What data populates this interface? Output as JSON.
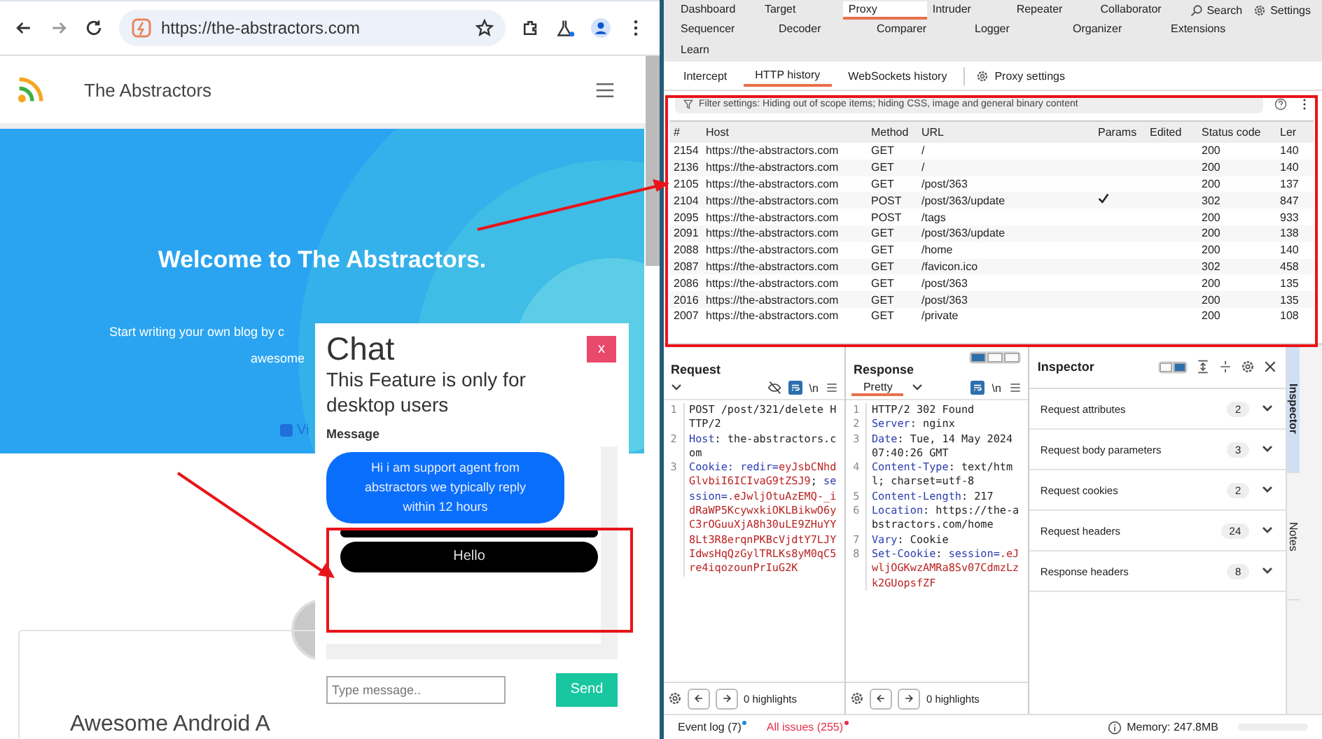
{
  "browser": {
    "url": "https://the-abstractors.com"
  },
  "site": {
    "title": "The Abstractors",
    "hero_title": "Welcome to The Abstractors.",
    "hero_lines": [
      "Start writing your own blog by c",
      "awesome"
    ],
    "hero_link": "Vi",
    "card_title": "Awesome Android A"
  },
  "chat": {
    "title": "Chat",
    "subtitle": "This Feature is only for desktop users",
    "close": "x",
    "label": "Message",
    "placeholder": "Type message..",
    "send": "Send",
    "messages": [
      {
        "kind": "agent",
        "text": "Hi i am support agent from abstractors we typically reply within 12 hours"
      },
      {
        "kind": "blank"
      },
      {
        "kind": "user",
        "text": "Hello"
      }
    ]
  },
  "burp": {
    "nav_rows": [
      [
        {
          "label": "Dashboard",
          "selected": false
        },
        {
          "label": "Target",
          "selected": false
        },
        {
          "label": "Proxy",
          "selected": true
        },
        {
          "label": "Intruder",
          "selected": false
        },
        {
          "label": "Repeater",
          "selected": false
        },
        {
          "label": "Collaborator",
          "selected": false
        }
      ],
      [
        {
          "label": "Sequencer",
          "selected": false
        },
        {
          "label": "Decoder",
          "selected": false
        },
        {
          "label": "Comparer",
          "selected": false
        },
        {
          "label": "Logger",
          "selected": false
        },
        {
          "label": "Organizer",
          "selected": false
        },
        {
          "label": "Extensions",
          "selected": false
        }
      ],
      [
        {
          "label": "Learn",
          "selected": false
        }
      ]
    ],
    "search": "Search",
    "settings": "Settings",
    "subtabs": [
      {
        "label": "Intercept",
        "selected": false,
        "kind": "tab"
      },
      {
        "label": "HTTP history",
        "selected": true,
        "kind": "tab"
      },
      {
        "label": "WebSockets history",
        "selected": false,
        "kind": "tab"
      },
      {
        "label": "Proxy settings",
        "selected": false,
        "kind": "settings"
      }
    ],
    "filter": "Filter settings: Hiding out of scope items; hiding CSS, image and general binary content",
    "columns": [
      "#",
      "Host",
      "Method",
      "URL",
      "Params",
      "Edited",
      "Status code",
      "Ler"
    ],
    "rows": [
      {
        "num": "2154",
        "host": "https://the-abstractors.com",
        "method": "GET",
        "url": "/",
        "params": false,
        "status": "200",
        "length": "140"
      },
      {
        "num": "2136",
        "host": "https://the-abstractors.com",
        "method": "GET",
        "url": "/",
        "params": false,
        "status": "200",
        "length": "140"
      },
      {
        "num": "2105",
        "host": "https://the-abstractors.com",
        "method": "GET",
        "url": "/post/363",
        "params": false,
        "status": "200",
        "length": "137"
      },
      {
        "num": "2104",
        "host": "https://the-abstractors.com",
        "method": "POST",
        "url": "/post/363/update",
        "params": true,
        "status": "302",
        "length": "847"
      },
      {
        "num": "2095",
        "host": "https://the-abstractors.com",
        "method": "POST",
        "url": "/tags",
        "params": false,
        "status": "200",
        "length": "933"
      },
      {
        "num": "2091",
        "host": "https://the-abstractors.com",
        "method": "GET",
        "url": "/post/363/update",
        "params": false,
        "status": "200",
        "length": "138"
      },
      {
        "num": "2088",
        "host": "https://the-abstractors.com",
        "method": "GET",
        "url": "/home",
        "params": false,
        "status": "200",
        "length": "140"
      },
      {
        "num": "2087",
        "host": "https://the-abstractors.com",
        "method": "GET",
        "url": "/favicon.ico",
        "params": false,
        "status": "302",
        "length": "458"
      },
      {
        "num": "2086",
        "host": "https://the-abstractors.com",
        "method": "GET",
        "url": "/post/363",
        "params": false,
        "status": "200",
        "length": "135"
      },
      {
        "num": "2016",
        "host": "https://the-abstractors.com",
        "method": "GET",
        "url": "/post/363",
        "params": false,
        "status": "200",
        "length": "135"
      },
      {
        "num": "2007",
        "host": "https://the-abstractors.com",
        "method": "GET",
        "url": "/private",
        "params": false,
        "status": "200",
        "length": "108"
      }
    ],
    "request": {
      "title": "Request",
      "newline": "\\n",
      "highlights": "0 highlights",
      "lines": [
        {
          "num": "1",
          "parts": [
            {
              "kind": "plain",
              "text": "POST /post/321/delete HTTP/2"
            }
          ]
        },
        {
          "num": "2",
          "parts": [
            {
              "kind": "name",
              "text": "Host"
            },
            {
              "kind": "plain",
              "text": ": the-abstractors.com"
            }
          ]
        },
        {
          "num": "3",
          "parts": [
            {
              "kind": "name",
              "text": "Cookie: redir="
            },
            {
              "kind": "value",
              "text": "eyJsbCNhdGlvbiI6ICIvaG9tZSJ9"
            },
            {
              "kind": "plain",
              "text": "; "
            },
            {
              "kind": "name",
              "text": "session="
            },
            {
              "kind": "value",
              "text": ".eJwljOtuAzEMQ-_idRaWP5KcywxkiOKLBikwO6yC3rOGuuXjA8h30uLE9ZHuYY8Lt3R8erqnPKBcVjdtY7LJYIdwsHqQzGylTRLKs8yM0qC5re4iqozounPrIuG2K"
            }
          ]
        }
      ]
    },
    "response": {
      "title": "Response",
      "tab": "Pretty",
      "newline": "\\n",
      "layout": [
        {
          "selected": true
        },
        {
          "selected": false
        },
        {
          "selected": false
        }
      ],
      "highlights": "0 highlights",
      "lines": [
        {
          "num": "1",
          "parts": [
            {
              "kind": "plain",
              "text": "HTTP/2 302 Found"
            }
          ]
        },
        {
          "num": "2",
          "parts": [
            {
              "kind": "name",
              "text": "Server"
            },
            {
              "kind": "plain",
              "text": ": nginx"
            }
          ]
        },
        {
          "num": "3",
          "parts": [
            {
              "kind": "name",
              "text": "Date"
            },
            {
              "kind": "plain",
              "text": ": Tue, 14 May 2024 07:40:26 GMT"
            }
          ]
        },
        {
          "num": "4",
          "parts": [
            {
              "kind": "name",
              "text": "Content-Type"
            },
            {
              "kind": "plain",
              "text": ": text/html; charset=utf-8"
            }
          ]
        },
        {
          "num": "5",
          "parts": [
            {
              "kind": "name",
              "text": "Content-Length"
            },
            {
              "kind": "plain",
              "text": ": 217"
            }
          ]
        },
        {
          "num": "6",
          "parts": [
            {
              "kind": "name",
              "text": "Location"
            },
            {
              "kind": "plain",
              "text": ": https://the-abstractors.com/home"
            }
          ]
        },
        {
          "num": "7",
          "parts": [
            {
              "kind": "name",
              "text": "Vary"
            },
            {
              "kind": "plain",
              "text": ": Cookie"
            }
          ]
        },
        {
          "num": "8",
          "parts": [
            {
              "kind": "name",
              "text": "Set-Cookie"
            },
            {
              "kind": "plain",
              "text": ": "
            },
            {
              "kind": "name",
              "text": "session="
            },
            {
              "kind": "value",
              "text": ".eJwljOGKwzAMRa8Sv07CdmzLzk2GUopsfZF"
            }
          ]
        }
      ]
    },
    "inspector": {
      "title": "Inspector",
      "layout": [
        {
          "selected": false
        },
        {
          "selected": true
        }
      ],
      "sections": [
        {
          "label": "Request attributes",
          "count": "2"
        },
        {
          "label": "Request body parameters",
          "count": "3"
        },
        {
          "label": "Request cookies",
          "count": "2"
        },
        {
          "label": "Request headers",
          "count": "24"
        },
        {
          "label": "Response headers",
          "count": "8"
        }
      ]
    },
    "side_tabs": [
      {
        "label": "Inspector",
        "selected": true
      },
      {
        "label": "Notes",
        "selected": false
      }
    ],
    "status": {
      "event_log": "Event log (7)",
      "issues": "All issues (255)",
      "memory": "Memory: 247.8MB"
    }
  }
}
